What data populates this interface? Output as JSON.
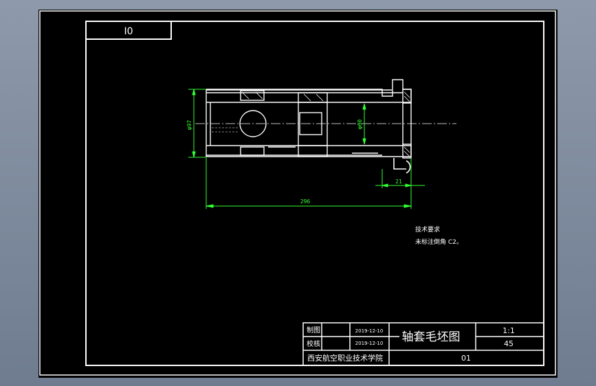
{
  "drawing": {
    "code_box": "I0",
    "dimensions": {
      "dia_left": "φ97",
      "dia_inner": "φ60",
      "small_right": "21",
      "overall_length": "296"
    },
    "tech_req": {
      "heading": "技术要求",
      "line1": "未标注倒角 C2。"
    }
  },
  "title_block": {
    "drawn_label": "制图",
    "drawn_date": "2019-12-10",
    "checked_label": "校核",
    "checked_date": "2019-12-10",
    "part_name": "轴套毛坯图",
    "scale": "1:1",
    "material": "45",
    "school": "西安航空职业技术学院",
    "drawing_no": "01"
  },
  "colors": {
    "background": "#000000",
    "lines": "#ffffff",
    "dimensions": "#33ff33",
    "frame_bg": "#7f8ca0"
  }
}
